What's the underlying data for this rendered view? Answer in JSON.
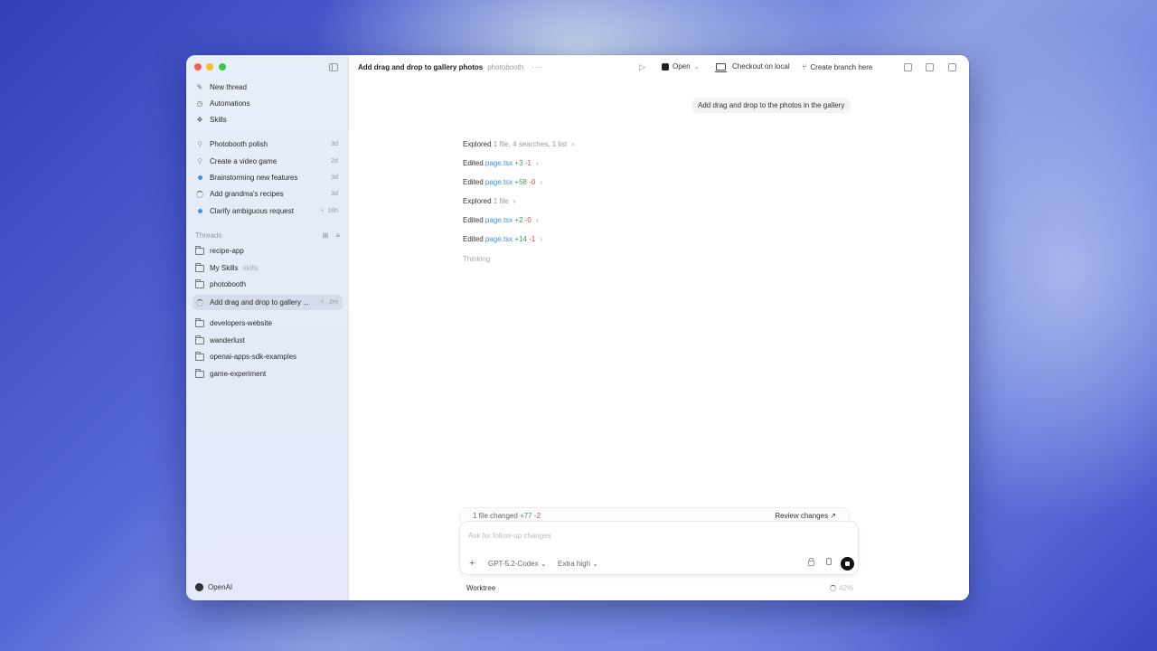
{
  "sidebar": {
    "nav": [
      {
        "label": "New thread",
        "icon": "edit-icon"
      },
      {
        "label": "Automations",
        "icon": "clock-icon"
      },
      {
        "label": "Skills",
        "icon": "skills-icon"
      }
    ],
    "recent": [
      {
        "label": "Photobooth polish",
        "time": "3d",
        "status": "pinned"
      },
      {
        "label": "Create a video game",
        "time": "2d",
        "status": "pinned"
      },
      {
        "label": "Brainstorming new features",
        "time": "3d",
        "status": "unread"
      },
      {
        "label": "Add grandma's recipes",
        "time": "3d",
        "status": "running"
      },
      {
        "label": "Clarify ambiguous request",
        "time": "16h",
        "status": "unread"
      }
    ],
    "threads_header": "Threads",
    "projects": [
      {
        "label": "recipe-app"
      },
      {
        "label": "My Skills",
        "sub": "skills"
      },
      {
        "label": "photobooth"
      }
    ],
    "active_thread": {
      "label": "Add drag and drop to gallery ...",
      "time": "2m"
    },
    "projects_more": [
      {
        "label": "developers-website"
      },
      {
        "label": "wanderlust"
      },
      {
        "label": "openai-apps-sdk-examples"
      },
      {
        "label": "game-experiment"
      }
    ],
    "account": "OpenAI"
  },
  "header": {
    "title": "Add drag and drop to gallery photos",
    "project": "photobooth",
    "more": "···",
    "open_label": "Open",
    "checkout_label": "Checkout on local",
    "branch_label": "Create branch here"
  },
  "conversation": {
    "user_message": "Add drag and drop to the photos in the gallery",
    "log": [
      {
        "verb": "Explored",
        "detail": "1 file, 4 searches, 1 list",
        "file": "",
        "add": "",
        "del": ""
      },
      {
        "verb": "Edited",
        "detail": "",
        "file": "page.tsx",
        "add": "+3",
        "del": "-1"
      },
      {
        "verb": "Edited",
        "detail": "",
        "file": "page.tsx",
        "add": "+58",
        "del": "-0"
      },
      {
        "verb": "Explored",
        "detail": "1 file",
        "file": "",
        "add": "",
        "del": ""
      },
      {
        "verb": "Edited",
        "detail": "",
        "file": "page.tsx",
        "add": "+2",
        "del": "-0"
      },
      {
        "verb": "Edited",
        "detail": "",
        "file": "page.tsx",
        "add": "+14",
        "del": "-1"
      }
    ],
    "status": "Thinking"
  },
  "changes": {
    "summary": "1 file changed",
    "add": "+77",
    "del": "-2",
    "review_label": "Review changes ↗"
  },
  "composer": {
    "placeholder": "Ask for follow-up changes",
    "model": "GPT-5.2-Codex",
    "effort": "Extra high"
  },
  "footer": {
    "mode": "Worktree",
    "context": "42%"
  },
  "colors": {
    "accent_blue": "#3f8ef0",
    "additions": "#3aa35a",
    "deletions": "#d84a4a"
  }
}
